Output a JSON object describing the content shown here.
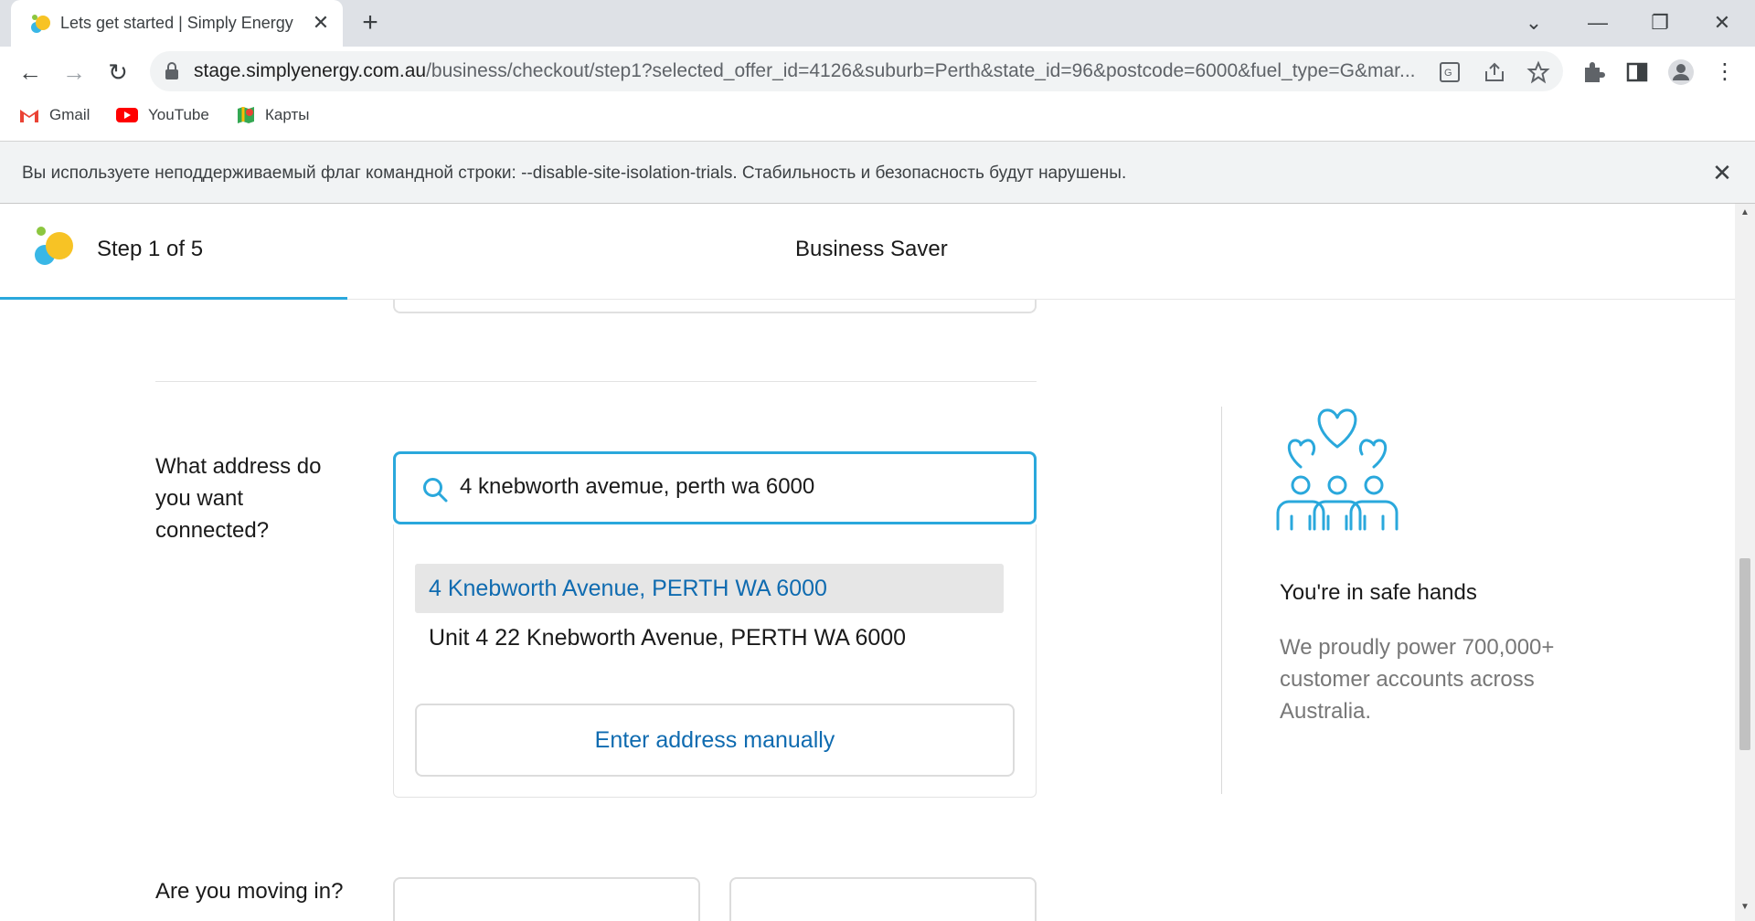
{
  "browser": {
    "tab_title": "Lets get started | Simply Energy",
    "url_domain": "stage.simplyenergy.com.au",
    "url_path": "/business/checkout/step1?selected_offer_id=4126&suburb=Perth&state_id=96&postcode=6000&fuel_type=G&mar...",
    "bookmarks": [
      {
        "label": "Gmail",
        "icon": "gmail-icon"
      },
      {
        "label": "YouTube",
        "icon": "youtube-icon"
      },
      {
        "label": "Карты",
        "icon": "maps-icon"
      }
    ],
    "infobar_text": "Вы используете неподдерживаемый флаг командной строки: --disable-site-isolation-trials. Стабильность и безопасность будут нарушены."
  },
  "header": {
    "step": "Step 1 of 5",
    "plan": "Business Saver",
    "progress_fraction": 0.2
  },
  "address": {
    "question": "What address do you want connected?",
    "input_value": "4 knebworth avemue, perth wa 6000",
    "suggestions": [
      "4 Knebworth Avenue, PERTH WA 6000",
      "Unit 4 22 Knebworth Avenue, PERTH WA 6000"
    ],
    "manual_button": "Enter address manually"
  },
  "aside": {
    "title": "You're in safe hands",
    "body": "We proudly power 700,000+ customer accounts across Australia."
  },
  "moving": {
    "question": "Are you moving in?"
  },
  "colors": {
    "accent": "#2aa8dc",
    "link": "#0f6bb0",
    "muted_text": "#777777"
  }
}
